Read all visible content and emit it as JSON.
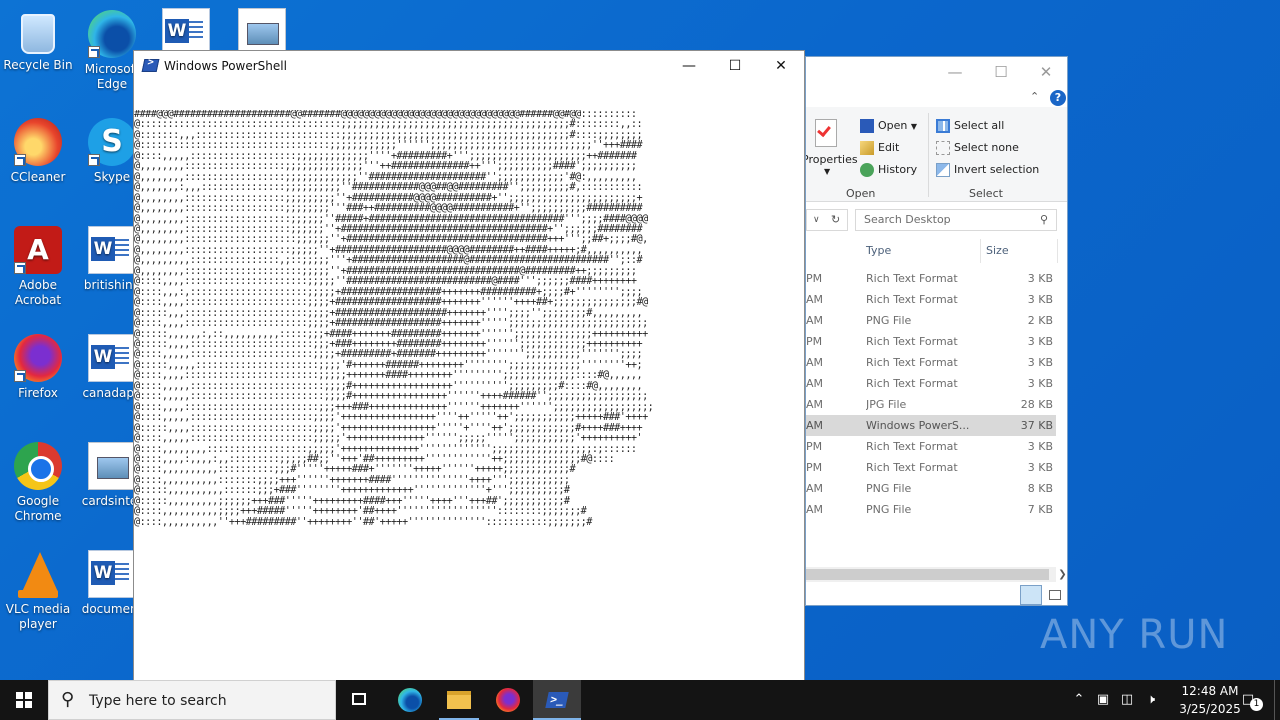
{
  "desktop": {
    "icons": [
      {
        "label": "Recycle Bin"
      },
      {
        "label": "Microsoft Edge"
      },
      {
        "label": "CCleaner"
      },
      {
        "label": "Skype"
      },
      {
        "label": "Adobe Acrobat"
      },
      {
        "label": "britishind"
      },
      {
        "label": "Firefox"
      },
      {
        "label": "canadaph"
      },
      {
        "label": "Google Chrome"
      },
      {
        "label": "cardsinter"
      },
      {
        "label": "VLC media player"
      },
      {
        "label": "document"
      }
    ]
  },
  "powershell": {
    "title": "Windows PowerShell",
    "output_lines": [
      "####@@@#####################@@#######@@@@@@@@@@@@@@@@@@@@@@@@@@@@@@@@######@@#@@::::::::::",
      "@::::::::::::::::::::::::::::::::::::;;;;;;;;;;;;;;;;;;;;;;;;;;;;;;;;;;;;;;;;;#::::::::,,::",
      "@:::::::,,,::::::::::::::::::::::::::;;;;;;;;;;;;;;;;;;;;;;;;;;;;;;;;;;;;;;;;;#::::;;;;;;;;",
      "@::::::::::::::::::::::::::::::::::;;;;;;;;;;;;'''''';;;;;;;;;;;;;;;;;;;;;;;;;;;;;''+++####",
      "@::::,,,,,:::::::::::::::::::;;;;;;;;;;;;;''''+#########+''';;;;;;;;;;;;;;;;;;;;;++#######",
      "@,,,,,,,,::::::::::::::::::;;;;;;;;;;;;;;'''++##############++''';;;;;;;;;;####';;;;;;;;;;",
      "@,,,,,,,,::::::::::::::::::;;;;;;;;;;;;;''#####################'';;;;;;;;;;;;'#@:,,,,,,,,,",
      "@,,,,,,,:,,,:::::::::::::::;;;;;;;;;;''############@@@##@@#########'';;;;;;;;;#,:::::::::::",
      "@,,,,,,,,::::::::::::::::::;;;;;;;;;''+###########@@@@##########+'';;;;;;;;;;;;;;;;;;;;;;;+",
      "@,,,,,,,,::::::::::::::::::;;;;;;;;'''###++##########@@@@###########+'';;;;;;;;;;##########",
      "@,,,,,,,,:::::::::::::::::::;;;;;;''#####+###################################''';;;;####@@@@",
      "@,,,,,,,,:::::::::::::::::::;;;;;;''+#####################################+'';;;;;;########",
      "@,,,,,,,,::::::::::::::::::::;;;;;;''+####################################+++''';;##+;;;;#@,",
      "@,,,,,,,,:::::::::::::::::::;;;;;''+####################@@@@########++####+++++;#,,,,,,,,,,",
      "@,,,,,,,,,::::::::::::::::,;::;;;;;'''+####################@#########################'';::#",
      "@,,,,,,,,:::::::::::::::::::::;;;;;''+###############################@#########++;;;;;;;;;",
      "@::::,,,,::::::::::::::::::::::;;;;;''##########################@####''';;;;;;####++++++++",
      "@::::,,,:,:::::::::::::::::::::;;;;;+##################+++++++##########+;;;;#+'''''''';;;;",
      "@::::,,,,::::::::::::::::::::::;;;;+###################+++++++''''''++++##+;;;;;;;;;;;;;;;#@",
      "@:::::,,,::::::::::::::::::::::;;;;+####################+++++++'''';;;;'';;;;;;;;#,,,,,,,,,",
      "@::::,,,,::::::::::::::::::::::;;;;+###################+++++++''''';;;;;;;;;;;;;;;;;;;;;;;;;",
      "@:::::,,,,,,:,::,,,,,,,,,,:::::;;;+####+++++++#########+++++++'''''';;;;;;;;;;;;;;++++++++++",
      "@:::::,,,,::::::::::::::::::::::;;;+###++++++++########++++++++'''''';;;;;;;;;;;;++++++++++",
      "@::::,,,,,::::::::::::::::::::::;;;;+#########+#######+++++++++''''''';;;;;;;;;;''''''';;;;",
      "@:::::,,,,,::::::::::::::::::::::;;;;'#++++++######++++++++'''''''';;;;;;;;;;;;;''''''''++;",
      "@::::,,,,::::::::::::::::::::::::;;;;;+++++++####++++++++''''''''';;;;;;;;;;;;;::::#@,,,,,,",
      "@::::,,,,,::::::::::::::::::::::::;;;;#++++++++++++++++++'''''''''';;;;;;;;;#::::#@,,,,,,,,",
      "@::::,,,,,::::::::::::::::::::::::;;;;#+++++++++++++++++''''''++++######'';;;;;;;;;;;;;;;;;;",
      "@::::,,,,::::::::::::::::::::::::;;;+++###++++++++++++++''''''+++++++'''''';;;;;;;;;;;;;;;;;;",
      "@::::,,,,,::::::::::::::::::::::;;;;'+++++++++++++++++''''++'''''++';;;;;;;;;;;+++++###'++++",
      "@:::::,,,,::::::::::::::::::::::;;;;'+++++++++++++++++'''''+''''++';;;;;;;;;;;;#++++###++++",
      "@::::,,,,,::::::::::::::::::::::;;;;;'++++++++++++++'''''';;;;;''''';;;;;;;;;;;'++++++++++'",
      "@::::,,,,,,,,::::::::::::::::::;;;;;'++++++++++++++''''''''''''';;;;;;;;;;;;;;;;;;:;::::::",
      "@::::,,,,:,,,,:,,:::::::::;;;;;##;;''+++'##+++++++++''''''''''''++;;;;;;;;;;;;;;#@::::",
      "@::::,,,,,,,,,,::::::::::;;;#'''''+++++###+'''''''+++++''''''+++++;;;;;;;;;;;;#",
      "@::::,,,,,,,,,,:::::::;;;;+++''''''+++++++####''''''''''''''++++''';;;;;;;;;;;",
      "@:::::,,,,,,,,,,::::::;;;+###''''''''+++++++++++++'''''''''''''+''';;;;;;;;;;#",
      "@:::::,,,,,,,,,;;;;;;+++###'''''+++++++++####+++'''''++++'''+++##';;;;;;;;;;;#",
      "@::::,,,,,,,,,,;;;;+++#####'''''++++++++'##++++''''''''''''''''''::::::::;;;;;;;#",
      "@::::,,,,,,,,,,''+++#########''++++++++''##'+++++'''''''''''''':::::::::::;;;;;;;#"
    ]
  },
  "explorer": {
    "ribbon": {
      "properties_label": "Properties",
      "open_label": "Open",
      "edit_label": "Edit",
      "history_label": "History",
      "select_all_label": "Select all",
      "select_none_label": "Select none",
      "invert_selection_label": "Invert selection",
      "group_open": "Open",
      "group_select": "Select"
    },
    "search_placeholder": "Search Desktop",
    "columns": {
      "type": "Type",
      "size": "Size"
    },
    "rows": [
      {
        "time": "PM",
        "type": "Rich Text Format",
        "size": "3 KB"
      },
      {
        "time": "AM",
        "type": "Rich Text Format",
        "size": "3 KB"
      },
      {
        "time": "AM",
        "type": "PNG File",
        "size": "2 KB"
      },
      {
        "time": "PM",
        "type": "Rich Text Format",
        "size": "3 KB"
      },
      {
        "time": "AM",
        "type": "Rich Text Format",
        "size": "3 KB"
      },
      {
        "time": "AM",
        "type": "Rich Text Format",
        "size": "3 KB"
      },
      {
        "time": "AM",
        "type": "JPG File",
        "size": "28 KB"
      },
      {
        "time": "AM",
        "type": "Windows PowerS...",
        "size": "37 KB",
        "selected": true
      },
      {
        "time": "PM",
        "type": "Rich Text Format",
        "size": "3 KB"
      },
      {
        "time": "PM",
        "type": "Rich Text Format",
        "size": "3 KB"
      },
      {
        "time": "AM",
        "type": "PNG File",
        "size": "8 KB"
      },
      {
        "time": "AM",
        "type": "PNG File",
        "size": "7 KB"
      }
    ]
  },
  "taskbar": {
    "search_placeholder": "Type here to search",
    "clock_time": "12:48 AM",
    "clock_date": "3/25/2025",
    "notification_count": "1"
  },
  "watermark": "ANY RUN"
}
